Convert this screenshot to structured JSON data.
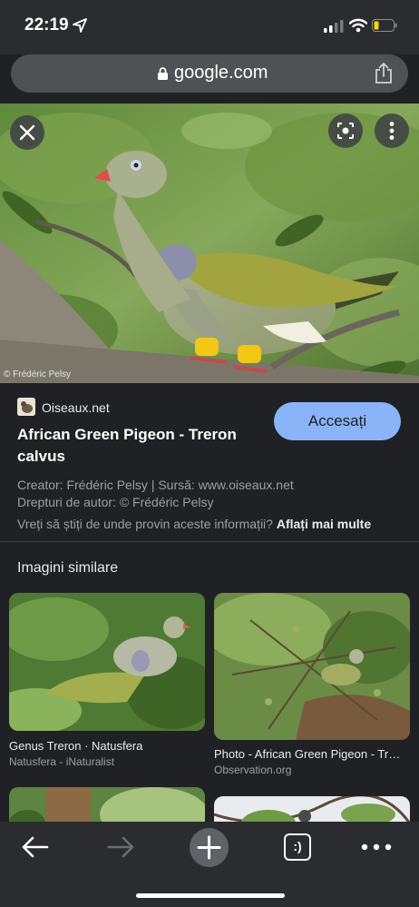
{
  "status": {
    "time": "22:19"
  },
  "browser": {
    "url": "google.com"
  },
  "image": {
    "credit": "© Frédéric Pelsy"
  },
  "result": {
    "source": "Oiseaux.net",
    "title": "African Green Pigeon - Treron calvus",
    "visit_label": "Accesați",
    "creator": "Creator: Frédéric Pelsy | Sursă: www.oiseaux.net",
    "copyright": "Drepturi de autor: © Frédéric Pelsy",
    "learn_prefix": "Vreți să știți de unde provin aceste informații?",
    "learn_link": "Aflați mai multe"
  },
  "similar": {
    "heading": "Imagini similare",
    "cards": [
      {
        "title": "Genus Treron · Natusfera",
        "source": "Natusfera - iNaturalist"
      },
      {
        "title": "Photo - African Green Pigeon - Treron calvus",
        "source": "Observation.org"
      }
    ]
  },
  "toolbar": {
    "tab_badge": ":)"
  },
  "colors": {
    "accent": "#8ab4f8",
    "background": "#202124"
  },
  "icons": [
    "location-arrow-icon",
    "signal-icon",
    "wifi-icon",
    "battery-icon",
    "lock-icon",
    "share-icon",
    "close-icon",
    "lens-icon",
    "more-vert-icon",
    "back-arrow-icon",
    "forward-arrow-icon",
    "new-tab-icon",
    "tabs-icon",
    "more-horiz-icon"
  ]
}
